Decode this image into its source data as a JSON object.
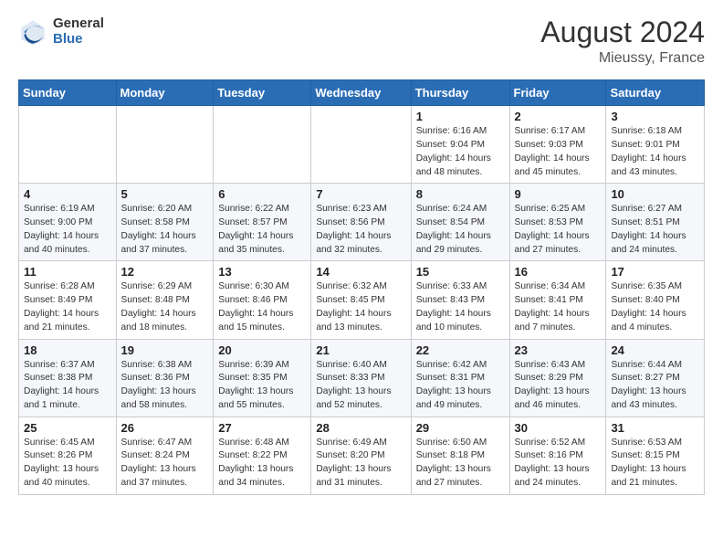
{
  "header": {
    "logo_general": "General",
    "logo_blue": "Blue",
    "main_title": "August 2024",
    "sub_title": "Mieussy, France"
  },
  "days_of_week": [
    "Sunday",
    "Monday",
    "Tuesday",
    "Wednesday",
    "Thursday",
    "Friday",
    "Saturday"
  ],
  "weeks": [
    [
      {
        "day": "",
        "info": ""
      },
      {
        "day": "",
        "info": ""
      },
      {
        "day": "",
        "info": ""
      },
      {
        "day": "",
        "info": ""
      },
      {
        "day": "1",
        "info": "Sunrise: 6:16 AM\nSunset: 9:04 PM\nDaylight: 14 hours\nand 48 minutes."
      },
      {
        "day": "2",
        "info": "Sunrise: 6:17 AM\nSunset: 9:03 PM\nDaylight: 14 hours\nand 45 minutes."
      },
      {
        "day": "3",
        "info": "Sunrise: 6:18 AM\nSunset: 9:01 PM\nDaylight: 14 hours\nand 43 minutes."
      }
    ],
    [
      {
        "day": "4",
        "info": "Sunrise: 6:19 AM\nSunset: 9:00 PM\nDaylight: 14 hours\nand 40 minutes."
      },
      {
        "day": "5",
        "info": "Sunrise: 6:20 AM\nSunset: 8:58 PM\nDaylight: 14 hours\nand 37 minutes."
      },
      {
        "day": "6",
        "info": "Sunrise: 6:22 AM\nSunset: 8:57 PM\nDaylight: 14 hours\nand 35 minutes."
      },
      {
        "day": "7",
        "info": "Sunrise: 6:23 AM\nSunset: 8:56 PM\nDaylight: 14 hours\nand 32 minutes."
      },
      {
        "day": "8",
        "info": "Sunrise: 6:24 AM\nSunset: 8:54 PM\nDaylight: 14 hours\nand 29 minutes."
      },
      {
        "day": "9",
        "info": "Sunrise: 6:25 AM\nSunset: 8:53 PM\nDaylight: 14 hours\nand 27 minutes."
      },
      {
        "day": "10",
        "info": "Sunrise: 6:27 AM\nSunset: 8:51 PM\nDaylight: 14 hours\nand 24 minutes."
      }
    ],
    [
      {
        "day": "11",
        "info": "Sunrise: 6:28 AM\nSunset: 8:49 PM\nDaylight: 14 hours\nand 21 minutes."
      },
      {
        "day": "12",
        "info": "Sunrise: 6:29 AM\nSunset: 8:48 PM\nDaylight: 14 hours\nand 18 minutes."
      },
      {
        "day": "13",
        "info": "Sunrise: 6:30 AM\nSunset: 8:46 PM\nDaylight: 14 hours\nand 15 minutes."
      },
      {
        "day": "14",
        "info": "Sunrise: 6:32 AM\nSunset: 8:45 PM\nDaylight: 14 hours\nand 13 minutes."
      },
      {
        "day": "15",
        "info": "Sunrise: 6:33 AM\nSunset: 8:43 PM\nDaylight: 14 hours\nand 10 minutes."
      },
      {
        "day": "16",
        "info": "Sunrise: 6:34 AM\nSunset: 8:41 PM\nDaylight: 14 hours\nand 7 minutes."
      },
      {
        "day": "17",
        "info": "Sunrise: 6:35 AM\nSunset: 8:40 PM\nDaylight: 14 hours\nand 4 minutes."
      }
    ],
    [
      {
        "day": "18",
        "info": "Sunrise: 6:37 AM\nSunset: 8:38 PM\nDaylight: 14 hours\nand 1 minute."
      },
      {
        "day": "19",
        "info": "Sunrise: 6:38 AM\nSunset: 8:36 PM\nDaylight: 13 hours\nand 58 minutes."
      },
      {
        "day": "20",
        "info": "Sunrise: 6:39 AM\nSunset: 8:35 PM\nDaylight: 13 hours\nand 55 minutes."
      },
      {
        "day": "21",
        "info": "Sunrise: 6:40 AM\nSunset: 8:33 PM\nDaylight: 13 hours\nand 52 minutes."
      },
      {
        "day": "22",
        "info": "Sunrise: 6:42 AM\nSunset: 8:31 PM\nDaylight: 13 hours\nand 49 minutes."
      },
      {
        "day": "23",
        "info": "Sunrise: 6:43 AM\nSunset: 8:29 PM\nDaylight: 13 hours\nand 46 minutes."
      },
      {
        "day": "24",
        "info": "Sunrise: 6:44 AM\nSunset: 8:27 PM\nDaylight: 13 hours\nand 43 minutes."
      }
    ],
    [
      {
        "day": "25",
        "info": "Sunrise: 6:45 AM\nSunset: 8:26 PM\nDaylight: 13 hours\nand 40 minutes."
      },
      {
        "day": "26",
        "info": "Sunrise: 6:47 AM\nSunset: 8:24 PM\nDaylight: 13 hours\nand 37 minutes."
      },
      {
        "day": "27",
        "info": "Sunrise: 6:48 AM\nSunset: 8:22 PM\nDaylight: 13 hours\nand 34 minutes."
      },
      {
        "day": "28",
        "info": "Sunrise: 6:49 AM\nSunset: 8:20 PM\nDaylight: 13 hours\nand 31 minutes."
      },
      {
        "day": "29",
        "info": "Sunrise: 6:50 AM\nSunset: 8:18 PM\nDaylight: 13 hours\nand 27 minutes."
      },
      {
        "day": "30",
        "info": "Sunrise: 6:52 AM\nSunset: 8:16 PM\nDaylight: 13 hours\nand 24 minutes."
      },
      {
        "day": "31",
        "info": "Sunrise: 6:53 AM\nSunset: 8:15 PM\nDaylight: 13 hours\nand 21 minutes."
      }
    ]
  ]
}
